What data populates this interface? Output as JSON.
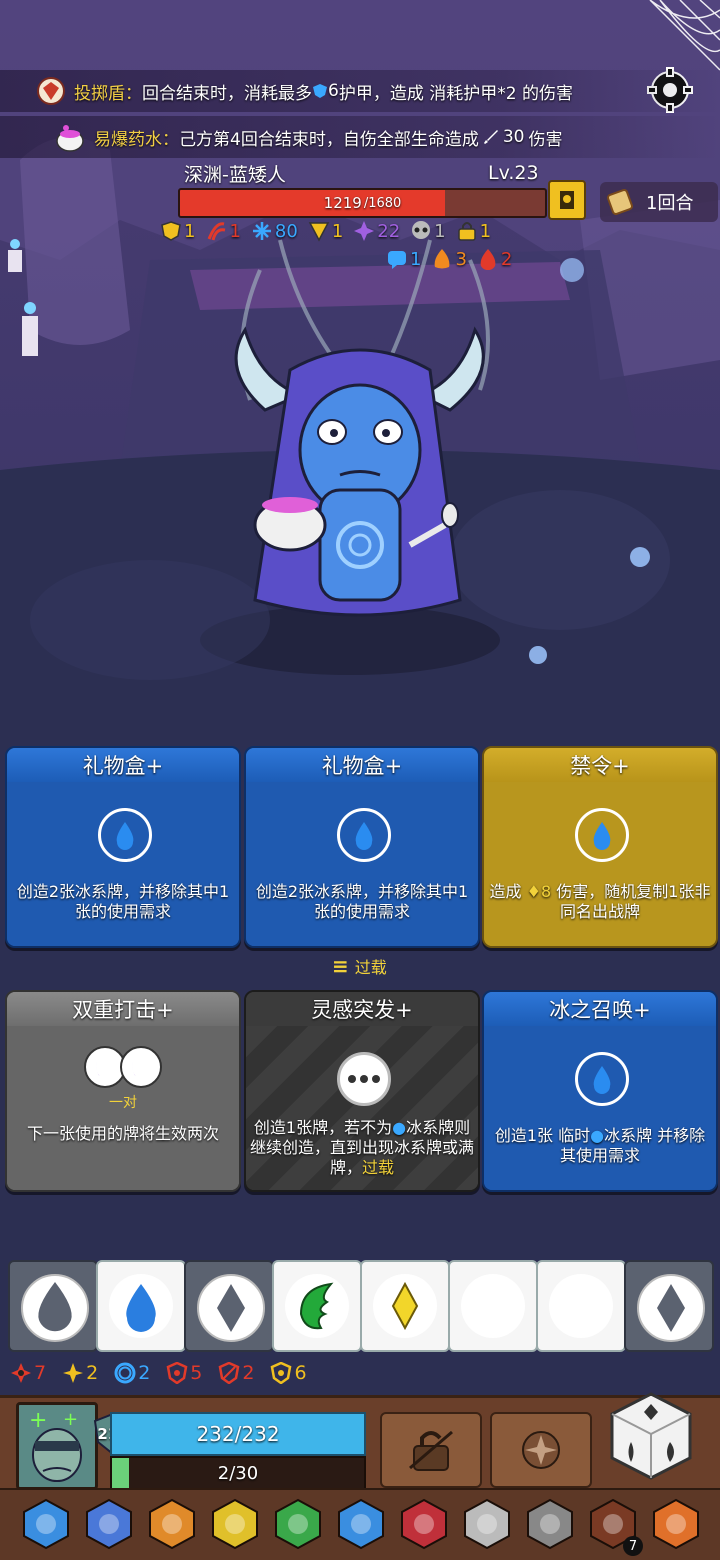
{
  "banners": [
    {
      "name": "投掷盾",
      "sep": "：",
      "text": "回合结束时，消耗最多",
      "value": "6",
      "text2": "护甲，造成 消耗护甲*2 的伤害",
      "icon": "shield-emblem-icon"
    },
    {
      "name": "易爆药水",
      "sep": "：",
      "text": "己方第4回合结束时，自伤全部生命造成",
      "value": "30",
      "text2": "伤害",
      "icon": "potion-icon"
    }
  ],
  "enemy": {
    "name": "深渊-蓝矮人",
    "level": "Lv.23",
    "hp": 1219,
    "hp_text": "1219",
    "hp_max_text": "/1680",
    "hp_fraction": 0.7256,
    "turn_label": "1回合"
  },
  "enemy_status": [
    {
      "icon": "shield-stack-icon",
      "value": "1",
      "color": "#f0c020"
    },
    {
      "icon": "red-claw-icon",
      "value": "1",
      "color": "#e23a2a"
    },
    {
      "icon": "snowflake-icon",
      "value": "80",
      "color": "#3aa8ff"
    },
    {
      "icon": "yellow-triangle-icon",
      "value": "1",
      "color": "#f0c020"
    },
    {
      "icon": "purple-burst-icon",
      "value": "22",
      "color": "#a060e0"
    },
    {
      "icon": "skull-icon",
      "value": "1",
      "color": "#bbbbbb"
    },
    {
      "icon": "lock-icon",
      "value": "1",
      "color": "#f0c020"
    }
  ],
  "enemy_status2": [
    {
      "icon": "speech-icon",
      "value": "1",
      "color": "#3aa8ff"
    },
    {
      "icon": "flame-icon",
      "value": "3",
      "color": "#f08a20"
    },
    {
      "icon": "blood-drop-icon",
      "value": "2",
      "color": "#e23a2a"
    }
  ],
  "cards": [
    {
      "title": "礼物盒+",
      "desc": "创造2张冰系牌，并移除其中1张的使用需求",
      "style": "blue"
    },
    {
      "title": "礼物盒+",
      "desc": "创造2张冰系牌，并移除其中1张的使用需求",
      "style": "blue"
    },
    {
      "title": "禁令+",
      "desc_a": "造成",
      "desc_value": "8",
      "desc_b": "伤害，随机复制1张非同名出战牌",
      "style": "gold"
    },
    {
      "title": "双重打击+",
      "tag": "一对",
      "desc": "下一张使用的牌将生效两次",
      "style": "gray"
    },
    {
      "title": "灵感突发+",
      "desc_a": "创造1张牌，若不为",
      "desc_b": "冰系牌则继续创造，直到出现冰系牌或满牌，",
      "desc_hl": "过载",
      "style": "dark"
    },
    {
      "title": "冰之召唤+",
      "desc_a": "创造1张 临时",
      "desc_b": "冰系牌 并移除其使用需求",
      "style": "blue"
    }
  ],
  "overload_label": "过载",
  "slots": [
    {
      "icon": "gray-drop-icon",
      "bg": "g"
    },
    {
      "icon": "blue-drop-icon",
      "bg": "w"
    },
    {
      "icon": "gray-diamond-icon",
      "bg": "g"
    },
    {
      "icon": "green-leaf-icon",
      "bg": "w"
    },
    {
      "icon": "yellow-diamond-icon",
      "bg": "w"
    },
    {
      "icon": "purple-moon-icon",
      "bg": "w"
    },
    {
      "icon": "purple-moon-icon",
      "bg": "w"
    },
    {
      "icon": "gray-diamond-icon",
      "bg": "g"
    }
  ],
  "player_stats": [
    {
      "icon": "red-burst-icon",
      "value": "7",
      "color": "#e23a2a"
    },
    {
      "icon": "yellow-star-icon",
      "value": "2",
      "color": "#f0c020"
    },
    {
      "icon": "blue-ring-icon",
      "value": "2",
      "color": "#3aa8ff"
    },
    {
      "icon": "red-target-icon",
      "value": "5",
      "color": "#e23a2a"
    },
    {
      "icon": "red-shield-icon",
      "value": "2",
      "color": "#e23a2a"
    },
    {
      "icon": "yellow-shield-icon",
      "value": "6",
      "color": "#f0c020"
    }
  ],
  "player": {
    "armor": "210",
    "energy": "232/232",
    "energy_fraction": 1.0,
    "mana": "2/30",
    "mana_fraction": 0.0667
  },
  "items": [
    {
      "icon": "blue-crystal-icon"
    },
    {
      "icon": "potion-bottles-icon"
    },
    {
      "icon": "flame-hand-icon"
    },
    {
      "icon": "yellow-scroll-icon"
    },
    {
      "icon": "green-book-icon"
    },
    {
      "icon": "blue-shield-icon"
    },
    {
      "icon": "ruby-ring-icon"
    },
    {
      "icon": "spiked-crown-icon"
    },
    {
      "icon": "armor-icon"
    },
    {
      "icon": "button-icon",
      "badge": "7"
    },
    {
      "icon": "meat-icon"
    }
  ]
}
